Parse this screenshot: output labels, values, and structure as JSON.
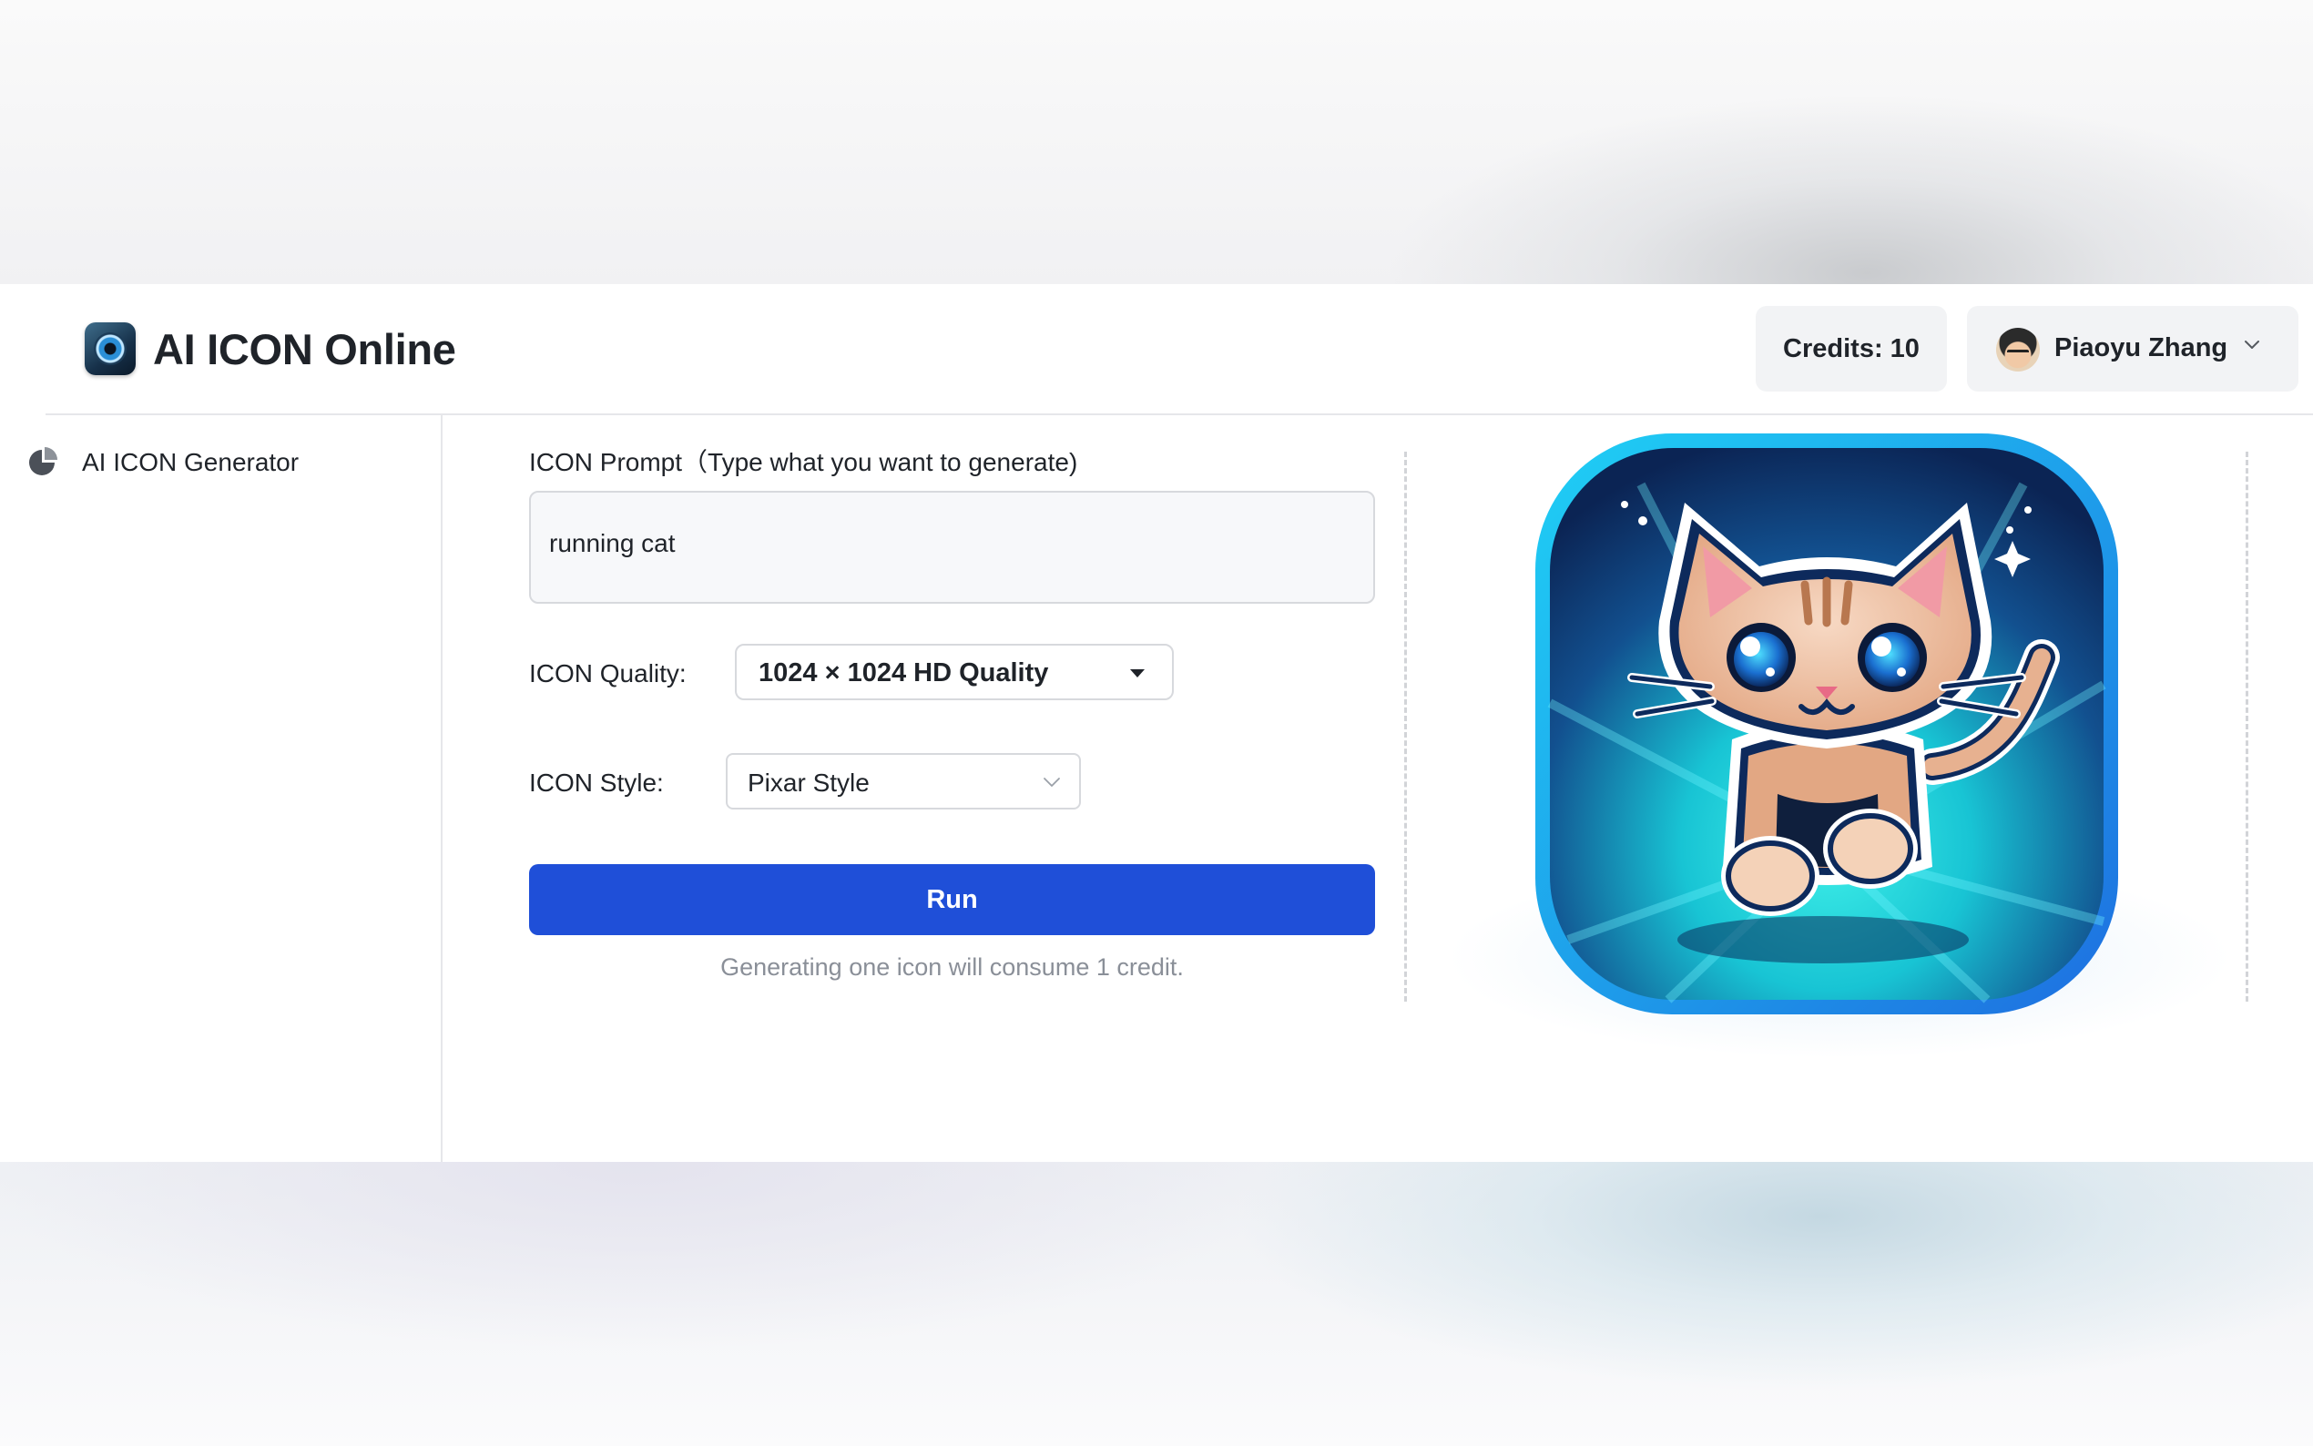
{
  "app": {
    "title": "AI ICON Online"
  },
  "header": {
    "credits_label": "Credits: 10",
    "user_name": "Piaoyu Zhang"
  },
  "sidebar": {
    "items": [
      {
        "label": "AI ICON Generator",
        "icon": "pie-chart-icon"
      }
    ]
  },
  "form": {
    "prompt_label": "ICON Prompt（Type what you want to generate)",
    "prompt_value": "running cat",
    "quality_label": "ICON Quality:",
    "quality_value": "1024 × 1024 HD Quality",
    "style_label": "ICON Style:",
    "style_value": "Pixar Style",
    "run_label": "Run",
    "hint": "Generating one icon will consume 1 credit."
  },
  "colors": {
    "primary": "#1f4fd8",
    "icon_border": "#18b8f0",
    "icon_teal": "#22e0e0",
    "icon_navy": "#0d2a5c"
  }
}
